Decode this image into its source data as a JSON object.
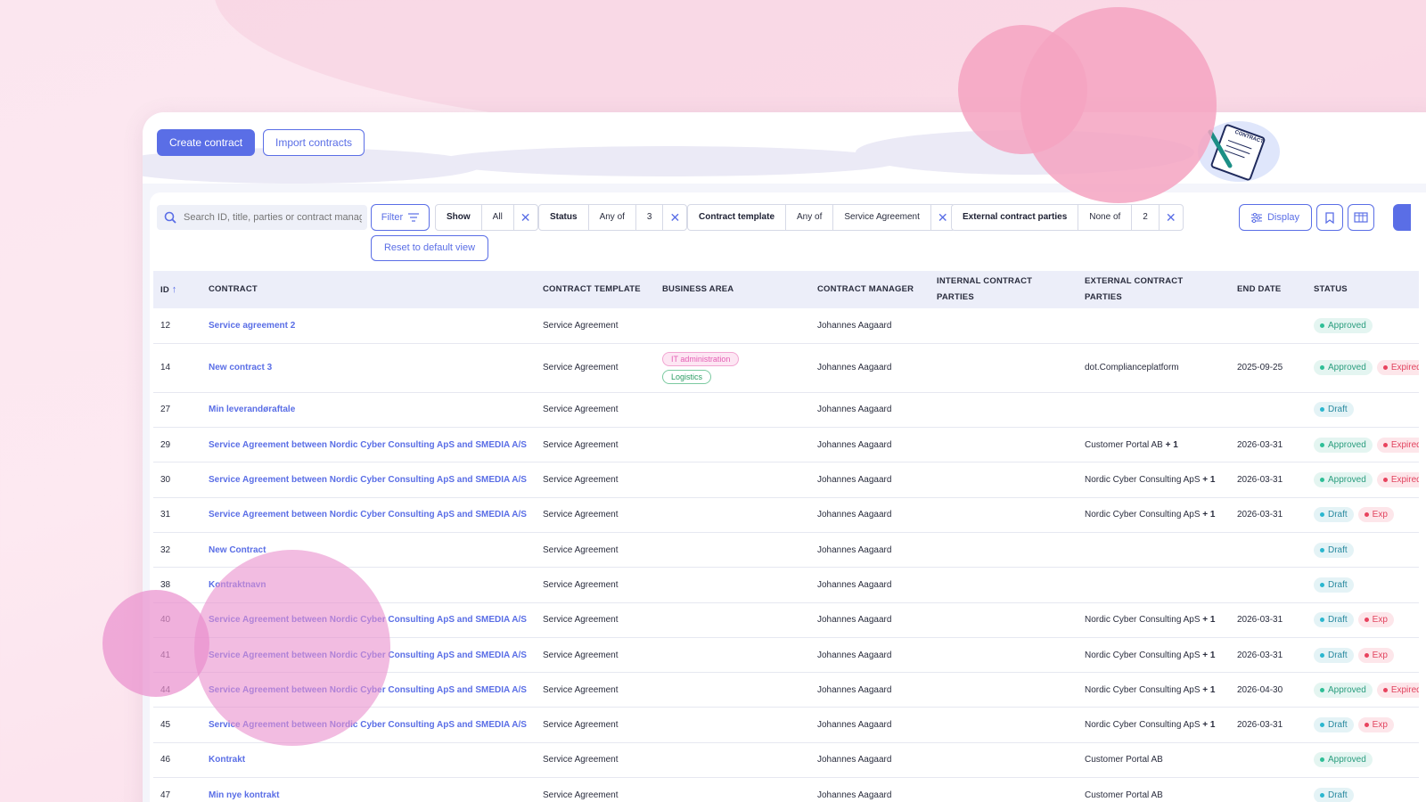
{
  "toolbar": {
    "create_label": "Create contract",
    "import_label": "Import contracts"
  },
  "illustration": {
    "label": "CONTRACT"
  },
  "filters": {
    "search_placeholder": "Search ID, title, parties or contract manag",
    "filter_label": "Filter",
    "show": {
      "key": "Show",
      "value": "All"
    },
    "status": {
      "key": "Status",
      "op": "Any of",
      "value": "3"
    },
    "template": {
      "key": "Contract template",
      "op": "Any of",
      "value": "Service Agreement"
    },
    "external": {
      "key": "External contract parties",
      "op": "None of",
      "value": "2"
    },
    "reset_label": "Reset to default view",
    "display_label": "Display"
  },
  "table": {
    "headers": {
      "id": "ID",
      "contract": "CONTRACT",
      "template": "CONTRACT TEMPLATE",
      "business_area": "BUSINESS AREA",
      "manager": "CONTRACT MANAGER",
      "internal": "INTERNAL CONTRACT PARTIES",
      "external": "EXTERNAL CONTRACT PARTIES",
      "end_date": "END DATE",
      "status": "STATUS"
    },
    "rows": [
      {
        "id": "12",
        "title": "Service agreement 2",
        "template": "Service Agreement",
        "areas": [],
        "manager": "Johannes Aagaard",
        "external": "",
        "plus": "",
        "end": "",
        "statuses": [
          "Approved"
        ]
      },
      {
        "id": "14",
        "title": "New contract 3",
        "template": "Service Agreement",
        "areas": [
          "IT administration",
          "Logistics"
        ],
        "manager": "Johannes Aagaard",
        "external": "dot.Complianceplatform",
        "plus": "",
        "end": "2025-09-25",
        "statuses": [
          "Approved",
          "Expired"
        ]
      },
      {
        "id": "27",
        "title": "Min leverandøraftale",
        "template": "Service Agreement",
        "areas": [],
        "manager": "Johannes Aagaard",
        "external": "",
        "plus": "",
        "end": "",
        "statuses": [
          "Draft"
        ]
      },
      {
        "id": "29",
        "title": "Service Agreement between Nordic Cyber Consulting ApS and SMEDIA A/S",
        "template": "Service Agreement",
        "areas": [],
        "manager": "Johannes Aagaard",
        "external": "Customer Portal AB",
        "plus": "+ 1",
        "end": "2026-03-31",
        "statuses": [
          "Approved",
          "Expired"
        ]
      },
      {
        "id": "30",
        "title": "Service Agreement between Nordic Cyber Consulting ApS and SMEDIA A/S",
        "template": "Service Agreement",
        "areas": [],
        "manager": "Johannes Aagaard",
        "external": "Nordic Cyber Consulting ApS",
        "plus": "+ 1",
        "end": "2026-03-31",
        "statuses": [
          "Approved",
          "Expired"
        ]
      },
      {
        "id": "31",
        "title": "Service Agreement between Nordic Cyber Consulting ApS and SMEDIA A/S",
        "template": "Service Agreement",
        "areas": [],
        "manager": "Johannes Aagaard",
        "external": "Nordic Cyber Consulting ApS",
        "plus": "+ 1",
        "end": "2026-03-31",
        "statuses": [
          "Draft",
          "Exp"
        ]
      },
      {
        "id": "32",
        "title": "New Contract",
        "template": "Service Agreement",
        "areas": [],
        "manager": "Johannes Aagaard",
        "external": "",
        "plus": "",
        "end": "",
        "statuses": [
          "Draft"
        ]
      },
      {
        "id": "38",
        "title": "Kontraktnavn",
        "template": "Service Agreement",
        "areas": [],
        "manager": "Johannes Aagaard",
        "external": "",
        "plus": "",
        "end": "",
        "statuses": [
          "Draft"
        ]
      },
      {
        "id": "40",
        "title": "Service Agreement between Nordic Cyber Consulting ApS and SMEDIA A/S",
        "template": "Service Agreement",
        "areas": [],
        "manager": "Johannes Aagaard",
        "external": "Nordic Cyber Consulting ApS",
        "plus": "+ 1",
        "end": "2026-03-31",
        "statuses": [
          "Draft",
          "Exp"
        ]
      },
      {
        "id": "41",
        "title": "Service Agreement between Nordic Cyber Consulting ApS and SMEDIA A/S",
        "template": "Service Agreement",
        "areas": [],
        "manager": "Johannes Aagaard",
        "external": "Nordic Cyber Consulting ApS",
        "plus": "+ 1",
        "end": "2026-03-31",
        "statuses": [
          "Draft",
          "Exp"
        ]
      },
      {
        "id": "44",
        "title": "Service Agreement between Nordic Cyber Consulting ApS and SMEDIA A/S",
        "template": "Service Agreement",
        "areas": [],
        "manager": "Johannes Aagaard",
        "external": "Nordic Cyber Consulting ApS",
        "plus": "+ 1",
        "end": "2026-04-30",
        "statuses": [
          "Approved",
          "Expired"
        ]
      },
      {
        "id": "45",
        "title": "Service Agreement between Nordic Cyber Consulting ApS and SMEDIA A/S",
        "template": "Service Agreement",
        "areas": [],
        "manager": "Johannes Aagaard",
        "external": "Nordic Cyber Consulting ApS",
        "plus": "+ 1",
        "end": "2026-03-31",
        "statuses": [
          "Draft",
          "Exp"
        ]
      },
      {
        "id": "46",
        "title": "Kontrakt",
        "template": "Service Agreement",
        "areas": [],
        "manager": "Johannes Aagaard",
        "external": "Customer Portal AB",
        "plus": "",
        "end": "",
        "statuses": [
          "Approved"
        ]
      },
      {
        "id": "47",
        "title": "Min nye kontrakt",
        "template": "Service Agreement",
        "areas": [],
        "manager": "Johannes Aagaard",
        "external": "Customer Portal AB",
        "plus": "",
        "end": "",
        "statuses": [
          "Draft"
        ]
      }
    ]
  },
  "colors": {
    "accent": "#5a6ee6",
    "approved": "#2fbf97",
    "draft": "#2bb7cf",
    "expired": "#e8435e"
  }
}
